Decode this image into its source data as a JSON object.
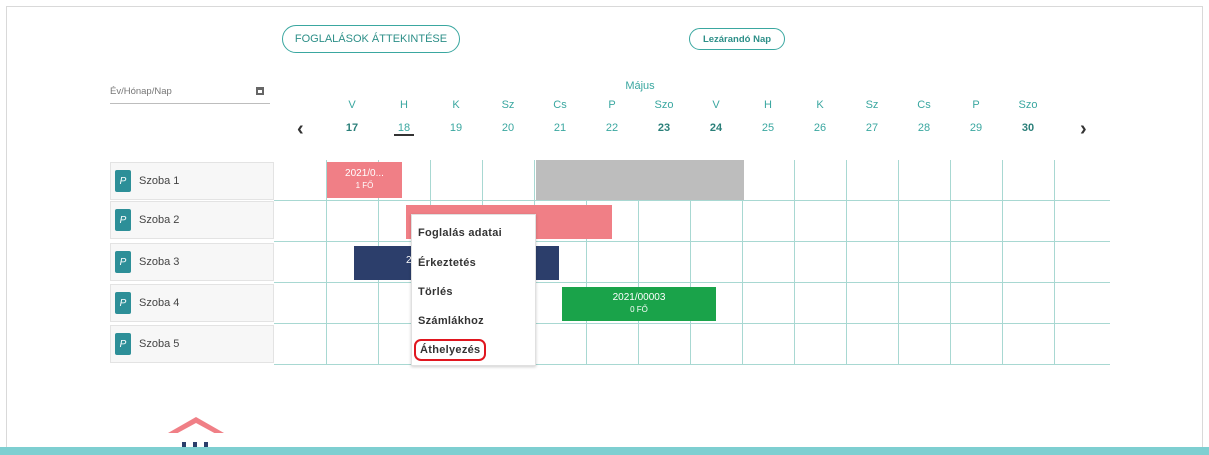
{
  "toolbar": {
    "overview_label": "FOGLALÁSOK ÁTTEKINTÉSE",
    "close_day_label": "Lezárandó Nap"
  },
  "datepicker": {
    "placeholder": "Év/Hónap/Nap",
    "icon": "calendar-icon"
  },
  "calendar": {
    "month": "Május",
    "days": [
      {
        "name": "V",
        "num": "17"
      },
      {
        "name": "H",
        "num": "18"
      },
      {
        "name": "K",
        "num": "19"
      },
      {
        "name": "Sz",
        "num": "20"
      },
      {
        "name": "Cs",
        "num": "21"
      },
      {
        "name": "P",
        "num": "22"
      },
      {
        "name": "Szo",
        "num": "23"
      },
      {
        "name": "V",
        "num": "24"
      },
      {
        "name": "H",
        "num": "25"
      },
      {
        "name": "K",
        "num": "26"
      },
      {
        "name": "Sz",
        "num": "27"
      },
      {
        "name": "Cs",
        "num": "28"
      },
      {
        "name": "P",
        "num": "29"
      },
      {
        "name": "Szo",
        "num": "30"
      }
    ],
    "prev_icon": "chevron-left-icon",
    "next_icon": "chevron-right-icon"
  },
  "rooms": [
    {
      "tag": "P",
      "name": "Szoba 1"
    },
    {
      "tag": "P",
      "name": "Szoba 2"
    },
    {
      "tag": "P",
      "name": "Szoba 3"
    },
    {
      "tag": "P",
      "name": "Szoba 4"
    },
    {
      "tag": "P",
      "name": "Szoba 5"
    }
  ],
  "bookings": {
    "b1": {
      "id": "2021/0...",
      "guests": "1 FŐ"
    },
    "b3": {
      "id": "2"
    },
    "b4": {
      "id": "2021/00003",
      "guests": "0 FŐ"
    }
  },
  "context_menu": {
    "items": [
      "Foglalás adatai",
      "Érkeztetés",
      "Törlés",
      "Számlákhoz",
      "Áthelyezés"
    ]
  },
  "colors": {
    "accent": "#3aa7a0",
    "booking_pink": "#f07f86",
    "booking_navy": "#2c3e6b",
    "booking_green": "#1aa34a",
    "highlight_red": "#e0161f"
  }
}
